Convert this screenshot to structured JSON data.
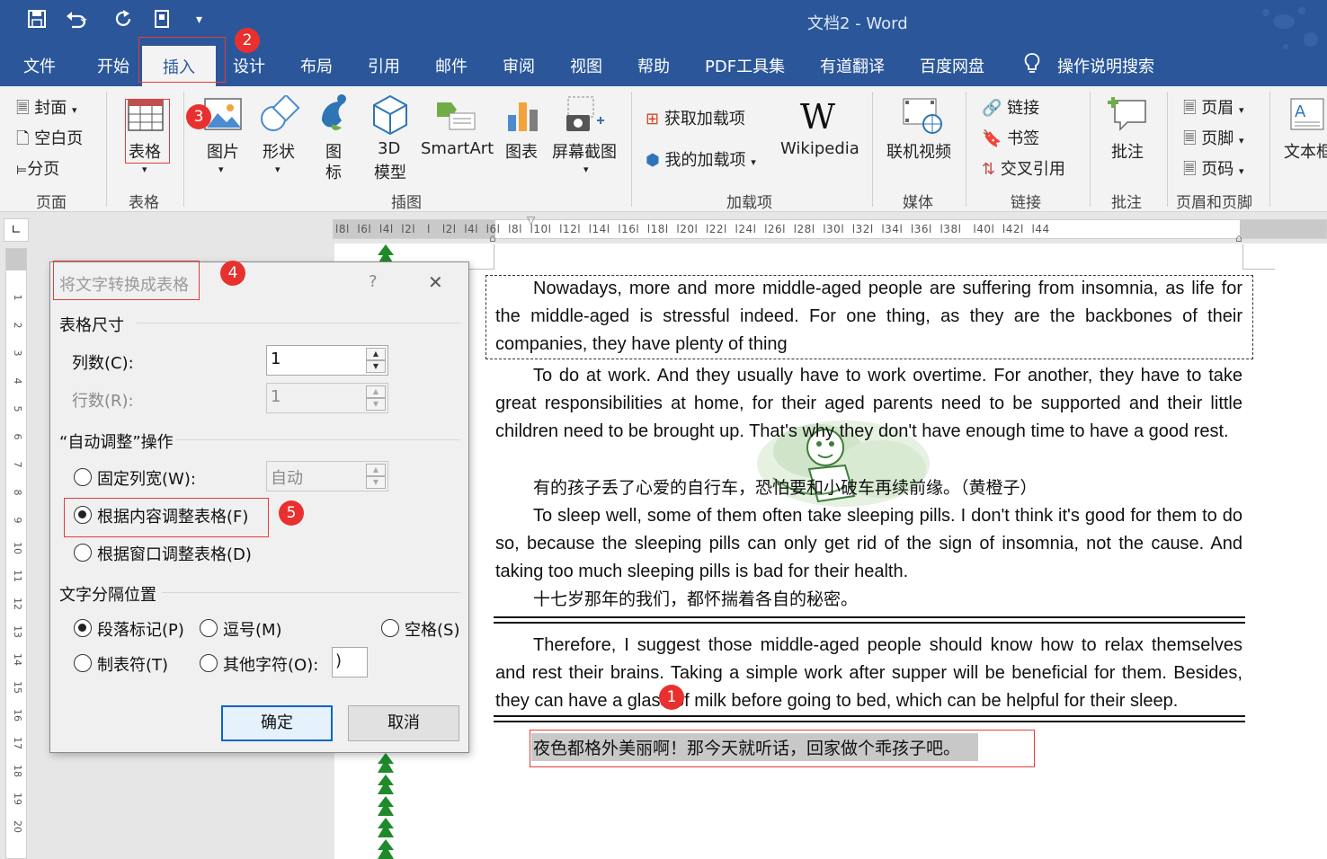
{
  "titlebar": {
    "title": "文档2  -  Word",
    "bg": "#2b579a"
  },
  "tabs": [
    {
      "label": "文件"
    },
    {
      "label": "开始"
    },
    {
      "label": "插入"
    },
    {
      "label": "设计"
    },
    {
      "label": "布局"
    },
    {
      "label": "引用"
    },
    {
      "label": "邮件"
    },
    {
      "label": "审阅"
    },
    {
      "label": "视图"
    },
    {
      "label": "帮助"
    },
    {
      "label": "PDF工具集"
    },
    {
      "label": "有道翻译"
    },
    {
      "label": "百度网盘"
    },
    {
      "label": "操作说明搜索"
    }
  ],
  "ribbon": {
    "pages": {
      "cover": "封面",
      "blank": "空白页",
      "break": "分页",
      "label": "页面"
    },
    "table": {
      "button": "表格",
      "label": "表格"
    },
    "illustrations": {
      "picture": "图片",
      "shapes": "形状",
      "icons_1": "图",
      "icons_2": "标",
      "model_1": "3D",
      "model_2": "模型",
      "smartart": "SmartArt",
      "chart": "图表",
      "screenshot": "屏幕截图",
      "label": "插图"
    },
    "addins": {
      "get": "获取加载项",
      "my": "我的加载项",
      "wikipedia": "Wikipedia",
      "label": "加载项"
    },
    "media": {
      "video": "联机视频",
      "label": "媒体"
    },
    "links": {
      "link": "链接",
      "bookmark": "书签",
      "crossref": "交叉引用",
      "label": "链接"
    },
    "comments": {
      "comment": "批注",
      "label": "批注"
    },
    "header_footer": {
      "header": "页眉",
      "footer": "页脚",
      "page_number": "页码",
      "label": "页眉和页脚"
    },
    "text": {
      "textbox": "文本框"
    }
  },
  "ruler": {
    "ticks": "l8l  l6l  l4l  l2l   l   l2l  l4l  l6l  l8l  l10l  l12l  l14l  l16l  l18l  l20l  l22l  l24l  l26l  l28l  l30l  l32l  l34l  l36l  l38l   l40l  l42l  l44"
  },
  "document": {
    "p1": "Nowadays, more and more middle-aged people are suffering from insomnia, as life for the middle-aged is stressful indeed. For one thing, as they are the backbones of their companies, they have plenty of thing",
    "p2": "To do at work. And they usually have to work overtime. For another, they have to take great responsibilities at home, for their aged parents need to be supported and their little children need to be brought up. That's why they don't have enough time to have a good rest.",
    "cn1": "有的孩子丢了心爱的自行车，恐怕要和小破车再续前缘。（黄橙子）",
    "p3": "To sleep well, some of them often take sleeping pills. I don't think it's good for them to do so, because the sleeping pills can only get rid of the sign of insomnia, not the cause. And taking too much sleeping pills is bad for their health.",
    "cn2": "十七岁那年的我们，都怀揣着各自的秘密。",
    "p4": "Therefore, I suggest those middle-aged people should know how to relax themselves and rest their brains. Taking a simple work after supper will be beneficial for them. Besides, they can have a glass of milk before going to bed, which can be helpful for their sleep.",
    "cn3": "夜色都格外美丽啊！那今天就听话，回家做个乖孩子吧。"
  },
  "dialog": {
    "title": "将文字转换成表格",
    "help": "?",
    "close": "✕",
    "size_section": "表格尺寸",
    "columns_label": "列数(C):",
    "columns_value": "1",
    "rows_label": "行数(R):",
    "rows_value": "1",
    "autofit_section": "“自动调整”操作",
    "fixed_width": "固定列宽(W):",
    "fixed_width_value": "自动",
    "autofit_content": "根据内容调整表格(F)",
    "autofit_window": "根据窗口调整表格(D)",
    "separator_section": "文字分隔位置",
    "sep_paragraph": "段落标记(P)",
    "sep_comma": "逗号(M)",
    "sep_space": "空格(S)",
    "sep_tab": "制表符(T)",
    "sep_other": "其他字符(O):",
    "sep_other_value": ")",
    "ok": "确定",
    "cancel": "取消",
    "selected_autofit": "根据内容调整表格(F)",
    "selected_separator": "段落标记(P)"
  },
  "badges": [
    "1",
    "2",
    "3",
    "4",
    "5"
  ],
  "colors": {
    "accent": "#2b579a",
    "annotation": "#e63b3b",
    "badge": "#e8312f",
    "highlight": "#c8c8c8"
  }
}
